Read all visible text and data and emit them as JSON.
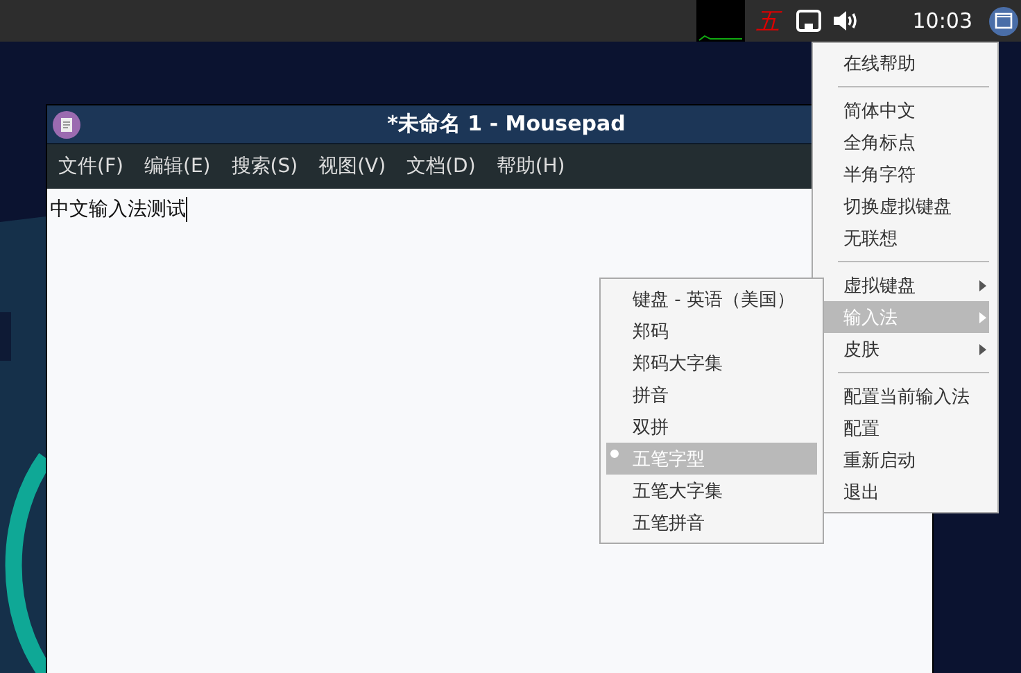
{
  "panel": {
    "input_method_indicator": "五",
    "clock": "10:03"
  },
  "window": {
    "title": "*未命名 1 - Mousepad",
    "menu": [
      "文件(F)",
      "编辑(E)",
      "搜索(S)",
      "视图(V)",
      "文档(D)",
      "帮助(H)"
    ],
    "text": "中文输入法测试"
  },
  "tray_menu": {
    "sections": [
      [
        {
          "label": "在线帮助",
          "kind": "item",
          "selected": false
        }
      ],
      [
        {
          "label": "简体中文",
          "kind": "item",
          "selected": false
        },
        {
          "label": "全角标点",
          "kind": "item",
          "selected": false
        },
        {
          "label": "半角字符",
          "kind": "item",
          "selected": false
        },
        {
          "label": "切换虚拟键盘",
          "kind": "item",
          "selected": false
        },
        {
          "label": "无联想",
          "kind": "item",
          "selected": false
        }
      ],
      [
        {
          "label": "虚拟键盘",
          "kind": "submenu",
          "selected": false
        },
        {
          "label": "输入法",
          "kind": "submenu",
          "selected": true
        },
        {
          "label": "皮肤",
          "kind": "submenu",
          "selected": false
        }
      ],
      [
        {
          "label": "配置当前输入法",
          "kind": "item",
          "selected": false
        },
        {
          "label": "配置",
          "kind": "item",
          "selected": false
        },
        {
          "label": "重新启动",
          "kind": "item",
          "selected": false
        },
        {
          "label": "退出",
          "kind": "item",
          "selected": false
        }
      ]
    ]
  },
  "input_method_menu": [
    {
      "label": "键盘 - 英语（美国）",
      "checked": false,
      "selected": false
    },
    {
      "label": "郑码",
      "checked": false,
      "selected": false
    },
    {
      "label": "郑码大字集",
      "checked": false,
      "selected": false
    },
    {
      "label": "拼音",
      "checked": false,
      "selected": false
    },
    {
      "label": "双拼",
      "checked": false,
      "selected": false
    },
    {
      "label": "五笔字型",
      "checked": true,
      "selected": true
    },
    {
      "label": "五笔大字集",
      "checked": false,
      "selected": false
    },
    {
      "label": "五笔拼音",
      "checked": false,
      "selected": false
    }
  ]
}
